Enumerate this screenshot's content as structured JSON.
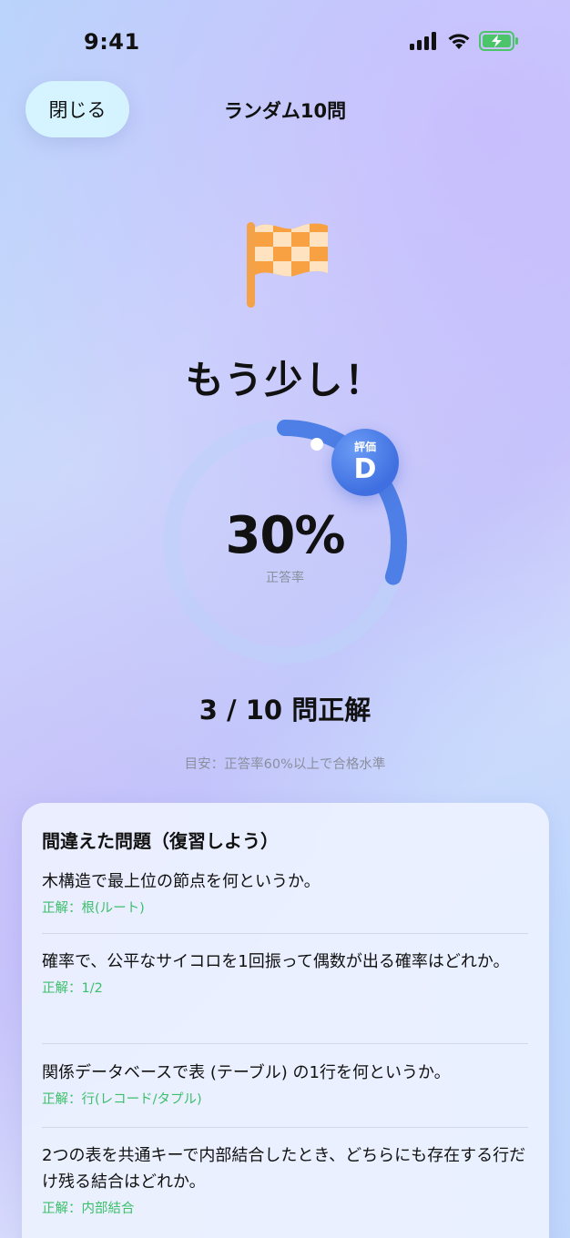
{
  "status_bar": {
    "time": "9:41"
  },
  "nav": {
    "close_label": "閉じる",
    "title": "ランダム10問"
  },
  "result": {
    "headline": "もう少し！",
    "percent_text": "30%",
    "percent_value": 30,
    "percent_label": "正答率",
    "grade_label": "評価",
    "grade": "D",
    "score_text": "3 / 10 問正解",
    "guide_text": "目安：正答率60%以上で合格水準"
  },
  "review": {
    "title": "間違えた問題（復習しよう）",
    "items": [
      {
        "question": "木構造で最上位の節点を何というか。",
        "answer": "正解：根(ルート)"
      },
      {
        "question": "確率で、公平なサイコロを1回振って偶数が出る確率はどれか。",
        "answer": "正解：1/2"
      },
      {
        "question": "関係データベースで表 (テーブル) の1行を何というか。",
        "answer": "正解：行(レコード/タプル)"
      },
      {
        "question": "2つの表を共通キーで内部結合したとき、どちらにも存在する行だけ残る結合はどれか。",
        "answer": "正解：内部結合"
      }
    ]
  },
  "colors": {
    "accent": "#3f6fe0",
    "correct": "#3cbf6b",
    "flag": "#f59a3a"
  },
  "icons": [
    "signal-icon",
    "wifi-icon",
    "battery-charging-icon",
    "checkered-flag-icon"
  ]
}
